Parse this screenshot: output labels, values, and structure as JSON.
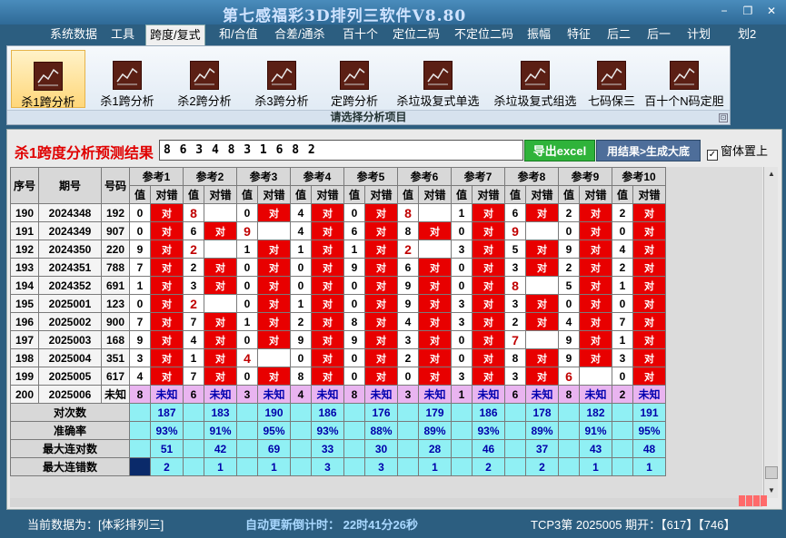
{
  "app": {
    "title": "第七感福彩3D排列三软件V8.80"
  },
  "window_controls": {
    "minimize": "−",
    "restore": "❐",
    "close": "✕"
  },
  "menu": [
    "系统数据",
    "工具",
    "跨度/复式",
    "和/合值",
    "合差/通杀",
    "百十个",
    "定位二码",
    "不定位二码",
    "振幅",
    "特征",
    "后二",
    "后一",
    "计划",
    "划2"
  ],
  "ribbon": {
    "buttons": [
      "杀1跨分析",
      "杀1跨分析",
      "杀2跨分析",
      "杀3跨分析",
      "定跨分析",
      "杀垃圾复式单选",
      "杀垃圾复式组选",
      "七码保三",
      "百十个N码定胆"
    ],
    "group_label": "请选择分析项目",
    "corner": "⊡"
  },
  "result": {
    "label": "杀1跨度分析预测结果",
    "value": "8 6 3 4 8 3 1 6 8 2",
    "export_button": "导出excel",
    "generate_button": "用结果>生成大底",
    "topmost_label": "窗体置上",
    "topmost_check": "✓"
  },
  "table": {
    "headers": {
      "seq": "序号",
      "period": "期号",
      "code": "号码"
    },
    "refs": [
      "参考1",
      "参考2",
      "参考3",
      "参考4",
      "参考5",
      "参考6",
      "参考7",
      "参考8",
      "参考9",
      "参考10"
    ],
    "sub_value": "值",
    "sub_hit": "对错",
    "hit_mark": "对",
    "rows": [
      {
        "seq": "190",
        "period": "2024348",
        "code": "192",
        "vals": [
          "0",
          "8",
          "0",
          "4",
          "0",
          "8",
          "1",
          "6",
          "2",
          "2"
        ],
        "hits": [
          1,
          0,
          1,
          1,
          1,
          0,
          1,
          1,
          1,
          1
        ]
      },
      {
        "seq": "191",
        "period": "2024349",
        "code": "907",
        "vals": [
          "0",
          "6",
          "9",
          "4",
          "6",
          "8",
          "0",
          "9",
          "0",
          "0"
        ],
        "hits": [
          1,
          1,
          0,
          1,
          1,
          1,
          1,
          0,
          1,
          1
        ]
      },
      {
        "seq": "192",
        "period": "2024350",
        "code": "220",
        "vals": [
          "9",
          "2",
          "1",
          "1",
          "1",
          "2",
          "3",
          "5",
          "9",
          "4"
        ],
        "hits": [
          1,
          0,
          1,
          1,
          1,
          0,
          1,
          1,
          1,
          1
        ]
      },
      {
        "seq": "193",
        "period": "2024351",
        "code": "788",
        "vals": [
          "7",
          "2",
          "0",
          "0",
          "9",
          "6",
          "0",
          "3",
          "2",
          "2"
        ],
        "hits": [
          1,
          1,
          1,
          1,
          1,
          1,
          1,
          1,
          1,
          1
        ]
      },
      {
        "seq": "194",
        "period": "2024352",
        "code": "691",
        "vals": [
          "1",
          "3",
          "0",
          "0",
          "0",
          "9",
          "0",
          "8",
          "5",
          "1"
        ],
        "hits": [
          1,
          1,
          1,
          1,
          1,
          1,
          1,
          0,
          1,
          1
        ]
      },
      {
        "seq": "195",
        "period": "2025001",
        "code": "123",
        "vals": [
          "0",
          "2",
          "0",
          "1",
          "0",
          "9",
          "3",
          "3",
          "0",
          "0"
        ],
        "hits": [
          1,
          0,
          1,
          1,
          1,
          1,
          1,
          1,
          1,
          1
        ]
      },
      {
        "seq": "196",
        "period": "2025002",
        "code": "900",
        "vals": [
          "7",
          "7",
          "1",
          "2",
          "8",
          "4",
          "3",
          "2",
          "4",
          "7"
        ],
        "hits": [
          1,
          1,
          1,
          1,
          1,
          1,
          1,
          1,
          1,
          1
        ]
      },
      {
        "seq": "197",
        "period": "2025003",
        "code": "168",
        "vals": [
          "9",
          "4",
          "0",
          "9",
          "9",
          "3",
          "0",
          "7",
          "9",
          "1"
        ],
        "hits": [
          1,
          1,
          1,
          1,
          1,
          1,
          1,
          0,
          1,
          1
        ]
      },
      {
        "seq": "198",
        "period": "2025004",
        "code": "351",
        "vals": [
          "3",
          "1",
          "4",
          "0",
          "0",
          "2",
          "0",
          "8",
          "9",
          "3"
        ],
        "hits": [
          1,
          1,
          0,
          1,
          1,
          1,
          1,
          1,
          1,
          1
        ]
      },
      {
        "seq": "199",
        "period": "2025005",
        "code": "617",
        "vals": [
          "4",
          "7",
          "0",
          "8",
          "0",
          "0",
          "3",
          "3",
          "6",
          "0"
        ],
        "hits": [
          1,
          1,
          1,
          1,
          1,
          1,
          1,
          1,
          0,
          1
        ]
      }
    ],
    "unknown_row": {
      "seq": "200",
      "period": "2025006",
      "code": "未知",
      "vals": [
        "8",
        "6",
        "3",
        "4",
        "8",
        "3",
        "1",
        "6",
        "8",
        "2"
      ],
      "mark": "未知"
    },
    "stats": [
      {
        "label": "对次数",
        "values": [
          "187",
          "183",
          "190",
          "186",
          "176",
          "179",
          "186",
          "178",
          "182",
          "191"
        ]
      },
      {
        "label": "准确率",
        "values": [
          "93%",
          "91%",
          "95%",
          "93%",
          "88%",
          "89%",
          "93%",
          "89%",
          "91%",
          "95%"
        ]
      },
      {
        "label": "最大连对数",
        "values": [
          "51",
          "42",
          "69",
          "33",
          "30",
          "28",
          "46",
          "37",
          "43",
          "48"
        ]
      },
      {
        "label": "最大连错数",
        "values": [
          "2",
          "1",
          "1",
          "3",
          "3",
          "1",
          "2",
          "2",
          "1",
          "1"
        ]
      }
    ]
  },
  "status": {
    "current": "当前数据为：[体彩排列三]",
    "timer": "自动更新倒计时： 22时41分26秒",
    "draw": "TCP3第 2025005 期开：【617】【746】"
  }
}
